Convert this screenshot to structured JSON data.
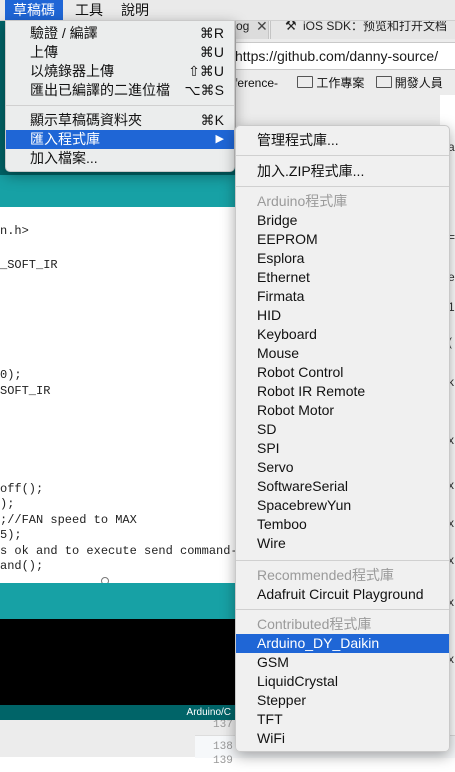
{
  "menubar": {
    "items": [
      {
        "label": "草稿碼",
        "active": true
      },
      {
        "label": "工具",
        "active": false
      },
      {
        "label": "說明",
        "active": false
      }
    ]
  },
  "sketch_menu": {
    "items": [
      {
        "label": "驗證 / 編譯",
        "shortcut": "⌘R"
      },
      {
        "label": "上傳",
        "shortcut": "⌘U"
      },
      {
        "label": "以燒錄器上傳",
        "shortcut": "⇧⌘U"
      },
      {
        "label": "匯出已編譯的二進位檔",
        "shortcut": "⌥⌘S"
      },
      {
        "label": "顯示草稿碼資料夾",
        "shortcut": "⌘K"
      },
      {
        "label": "匯入程式庫",
        "shortcut": "▶"
      },
      {
        "label": "加入檔案...",
        "shortcut": ""
      }
    ]
  },
  "library_submenu": {
    "manage_label": "管理程式庫...",
    "add_zip_label": "加入.ZIP程式庫...",
    "arduino_header": "Arduino程式庫",
    "arduino_libs": [
      "Bridge",
      "EEPROM",
      "Esplora",
      "Ethernet",
      "Firmata",
      "HID",
      "Keyboard",
      "Mouse",
      "Robot Control",
      "Robot IR Remote",
      "Robot Motor",
      "SD",
      "SPI",
      "Servo",
      "SoftwareSerial",
      "SpacebrewYun",
      "Temboo",
      "Wire"
    ],
    "recommended_header": "Recommended程式庫",
    "recommended_libs": [
      "Adafruit Circuit Playground"
    ],
    "contributed_header": "Contributed程式庫",
    "contributed_libs": [
      "Arduino_DY_Daikin",
      "GSM",
      "LiquidCrystal",
      "Stepper",
      "TFT",
      "WiFi"
    ]
  },
  "browser": {
    "tab1": "og",
    "tab2": "iOS SDK：预览和打开文档",
    "url": "https://github.com/danny-source/",
    "bookmark0": "ference-",
    "bookmark1": "工作專案",
    "bookmark2": "開發人員",
    "right_edge_chars": [
      "a",
      "=",
      "e",
      "1",
      "(",
      "k",
      "x",
      "x",
      "x",
      "x",
      "x",
      "x"
    ],
    "line_numbers": [
      "137",
      "138",
      "139"
    ]
  },
  "code": {
    "lines": [
      "n.h>",
      "_SOFT_IR",
      "0);",
      "SOFT_IR",
      "off();",
      ");",
      ";//FAN speed to MAX",
      "5);",
      "s ok and to execute send command--",
      "and();"
    ]
  },
  "ide": {
    "footer": "Arduino/C"
  },
  "colors": {
    "highlight": "#1f66d6",
    "ide_dark": "#006468",
    "ide_teal": "#17a1a5"
  }
}
